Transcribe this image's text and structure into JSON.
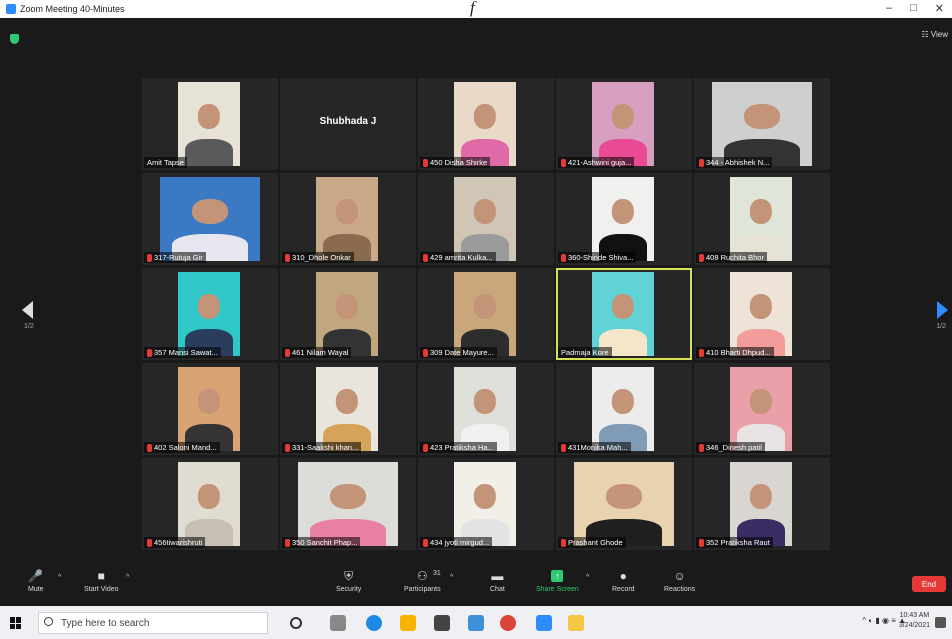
{
  "window": {
    "title": "Zoom Meeting 40-Minutes",
    "header_text": "f"
  },
  "top_right": {
    "view_label": "View"
  },
  "pagination": {
    "left": "1/2",
    "right": "1/2"
  },
  "colors": {
    "active_speaker": "#d4e157",
    "muted": "#e53935",
    "share": "#2ecc71",
    "end": "#e53935",
    "accent": "#2d8cff"
  },
  "participants": [
    {
      "name": "Amit Tapse",
      "muted": false,
      "video": true,
      "shirt": "#5a5a5a",
      "bg": "#e7e2d6"
    },
    {
      "name": "Shubhada J",
      "muted": false,
      "video": false
    },
    {
      "name": "450 Disha Shirke",
      "muted": true,
      "video": true,
      "shirt": "#e06aa8",
      "bg": "#e8d9c9"
    },
    {
      "name": "421-Ashwini guja...",
      "muted": true,
      "video": true,
      "shirt": "#e84a93",
      "bg": "#d7a0c0"
    },
    {
      "name": "344 - Abhishek N...",
      "muted": true,
      "video": true,
      "shirt": "#333",
      "bg": "#cfcfcf",
      "wide": true
    },
    {
      "name": "317-Rutuja Gir",
      "muted": true,
      "video": true,
      "shirt": "#e6e6f0",
      "bg": "#3b79c4",
      "wide": true
    },
    {
      "name": "310_Dhole Onkar",
      "muted": true,
      "video": true,
      "shirt": "#8a6b4f",
      "bg": "#c9a987"
    },
    {
      "name": "429 amrita Kulka...",
      "muted": true,
      "video": true,
      "shirt": "#9b9b9b",
      "bg": "#cfc6b5"
    },
    {
      "name": "360-Shinde Shiva...",
      "muted": true,
      "video": true,
      "shirt": "#111",
      "bg": "#f0f0ee"
    },
    {
      "name": "408 Ruchita Bhor",
      "muted": true,
      "video": true,
      "shirt": "#e7e3d4",
      "bg": "#dfe6d9"
    },
    {
      "name": "357 Mansi Sawat...",
      "muted": true,
      "video": true,
      "shirt": "#2a3d5c",
      "bg": "#30c7c9"
    },
    {
      "name": "461 Nilam Wayal",
      "muted": true,
      "video": true,
      "shirt": "#333",
      "bg": "#c0a77f"
    },
    {
      "name": "309 Date Mayure...",
      "muted": true,
      "video": true,
      "shirt": "#2d2d2d",
      "bg": "#c9a77a"
    },
    {
      "name": "Padmaja Kore",
      "muted": false,
      "video": true,
      "shirt": "#f5e6c9",
      "bg": "#5fd3d6",
      "active": true
    },
    {
      "name": "410 Bharti Dhpud...",
      "muted": true,
      "video": true,
      "shirt": "#f29c9c",
      "bg": "#efe2d6"
    },
    {
      "name": "402 Saloni Mand...",
      "muted": true,
      "video": true,
      "shirt": "#343434",
      "bg": "#d9a373"
    },
    {
      "name": "331-Saakshi khan...",
      "muted": true,
      "video": true,
      "shirt": "#d6a35a",
      "bg": "#e9e4dc"
    },
    {
      "name": "423 Pratiksha Ha...",
      "muted": true,
      "video": true,
      "shirt": "#f0f0f0",
      "bg": "#dfe0da"
    },
    {
      "name": "431Monika Mah...",
      "muted": true,
      "video": true,
      "shirt": "#7f9bb5",
      "bg": "#ececec"
    },
    {
      "name": "346_Dinesh patil",
      "muted": true,
      "video": true,
      "shirt": "#e9e4e4",
      "bg": "#e9a0a8"
    },
    {
      "name": "456tiwarishruti",
      "muted": true,
      "video": true,
      "shirt": "#c8bfb4",
      "bg": "#e1dcd2"
    },
    {
      "name": "350 Sanchit Phap...",
      "muted": true,
      "video": true,
      "shirt": "#e97fa3",
      "bg": "#dcdcd8",
      "wide": true
    },
    {
      "name": "434 jyoti mirgud...",
      "muted": true,
      "video": true,
      "shirt": "#e3e3e3",
      "bg": "#f1efe8"
    },
    {
      "name": "Prashant Ghode",
      "muted": true,
      "video": true,
      "shirt": "#202020",
      "bg": "#e8d2b0",
      "wide": true
    },
    {
      "name": "352 Pratiksha Raut",
      "muted": true,
      "video": true,
      "shirt": "#3b2c63",
      "bg": "#d9d6d2"
    }
  ],
  "toolbar": {
    "mute": "Mute",
    "start_video": "Start Video",
    "security": "Security",
    "participants": "Participants",
    "participants_count": "31",
    "chat": "Chat",
    "share_screen": "Share Screen",
    "record": "Record",
    "reactions": "Reactions",
    "end": "End"
  },
  "taskbar": {
    "search_placeholder": "Type here to search",
    "time": "10:43 AM",
    "date": "3/24/2021"
  }
}
